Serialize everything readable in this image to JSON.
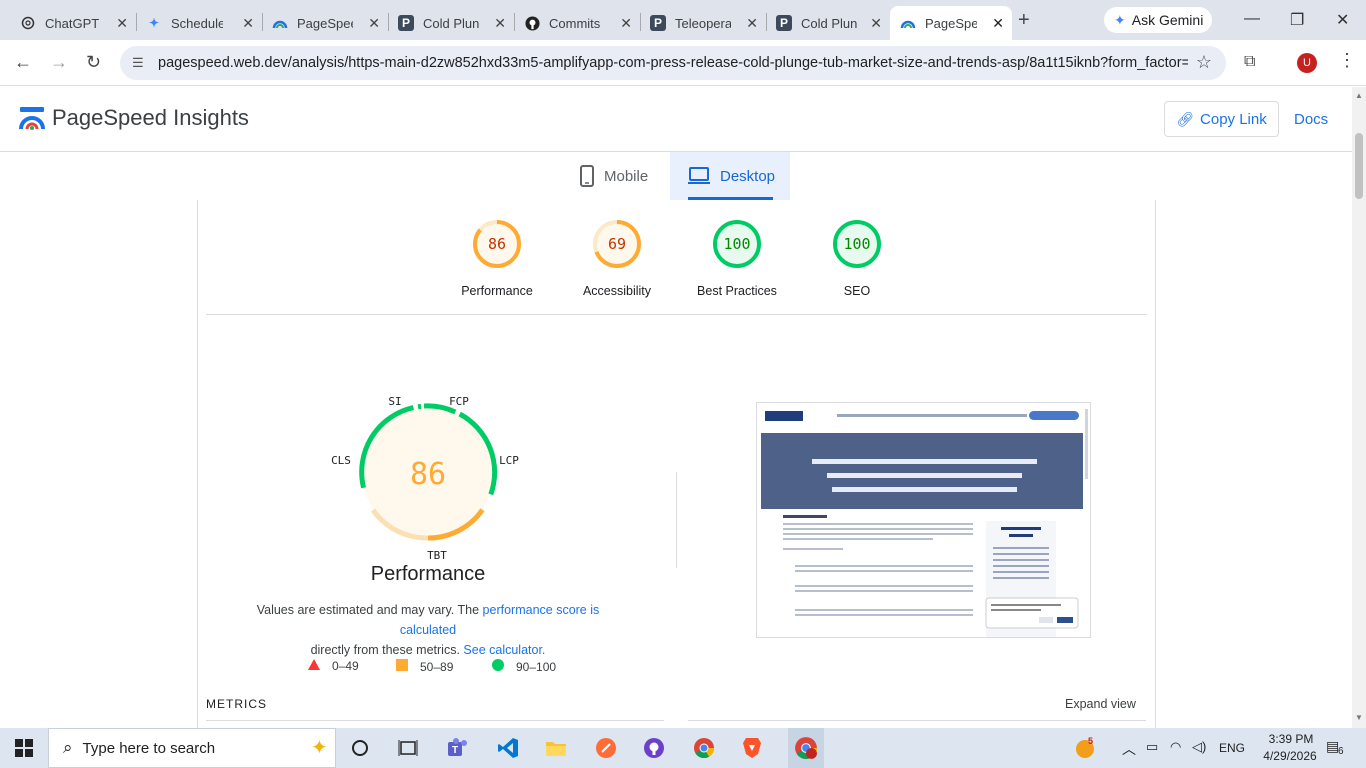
{
  "browser": {
    "tabs": [
      {
        "title": "ChatGPT",
        "icon": "chatgpt-icon"
      },
      {
        "title": "Scheduler",
        "icon": "gemini-star-icon"
      },
      {
        "title": "PageSpeed",
        "icon": "pagespeed-icon"
      },
      {
        "title": "Cold Plunge",
        "icon": "p-icon"
      },
      {
        "title": "Commits",
        "icon": "github-icon"
      },
      {
        "title": "Teleoperat",
        "icon": "p-icon"
      },
      {
        "title": "Cold Plunge",
        "icon": "p-icon"
      },
      {
        "title": "PageSpeed",
        "icon": "pagespeed-icon"
      }
    ],
    "ask_gemini": "Ask Gemini",
    "url": "pagespeed.web.dev/analysis/https-main-d2zw852hxd33m5-amplifyapp-com-press-release-cold-plunge-tub-market-size-and-trends-asp/8a1t15iknb?form_factor=d...",
    "profile_initial": "U"
  },
  "header": {
    "title": "PageSpeed Insights",
    "copy_link": "Copy Link",
    "docs": "Docs"
  },
  "device_tabs": {
    "mobile": "Mobile",
    "desktop": "Desktop"
  },
  "scores": [
    {
      "value": "86",
      "label": "Performance",
      "status": "average"
    },
    {
      "value": "69",
      "label": "Accessibility",
      "status": "average"
    },
    {
      "value": "100",
      "label": "Best Practices",
      "status": "pass"
    },
    {
      "value": "100",
      "label": "SEO",
      "status": "pass"
    }
  ],
  "performance": {
    "score": "86",
    "title": "Performance",
    "segments": {
      "si": "SI",
      "fcp": "FCP",
      "lcp": "LCP",
      "tbt": "TBT",
      "cls": "CLS"
    },
    "note_prefix": "Values are estimated and may vary. The",
    "note_link": "performance score is calculated",
    "note_middle": "directly from these metrics.",
    "note_calc": "See calculator."
  },
  "legend": {
    "fail": "0–49",
    "average": "50–89",
    "pass": "90–100"
  },
  "metrics": {
    "heading": "METRICS",
    "expand": "Expand view"
  },
  "taskbar": {
    "search_placeholder": "Type here to search",
    "language": "ENG",
    "time": "3:39 PM",
    "date": "4/29/2026",
    "notification_count": "6",
    "badge_count": "5"
  },
  "colors": {
    "average": "#fa3",
    "average_text": "#c33300",
    "pass": "#0c6",
    "pass_text": "#008800",
    "fail": "#f33",
    "link": "#1a73e8"
  }
}
